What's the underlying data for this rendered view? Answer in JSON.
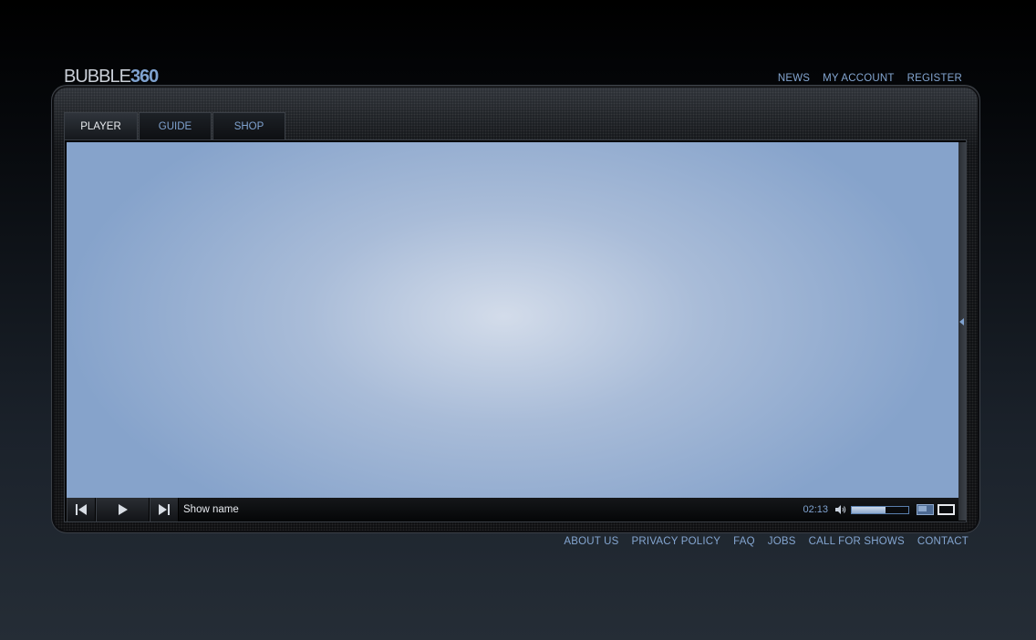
{
  "logo": {
    "word": "BUBBLE",
    "number": "360"
  },
  "top_nav": [
    "NEWS",
    "MY ACCOUNT",
    "REGISTER"
  ],
  "tabs": [
    {
      "label": "PLAYER",
      "active": true
    },
    {
      "label": "GUIDE",
      "active": false
    },
    {
      "label": "SHOP",
      "active": false
    }
  ],
  "player": {
    "show_name": "Show name",
    "time": "02:13",
    "volume_fraction": 0.6,
    "icons": [
      "skip-previous-icon",
      "play-icon",
      "skip-next-icon",
      "volume-icon",
      "window-size-icon",
      "fullscreen-icon",
      "collapse-arrow-icon"
    ]
  },
  "footer_nav": [
    "ABOUT US",
    "PRIVACY POLICY",
    "FAQ",
    "JOBS",
    "CALL FOR SHOWS",
    "CONTACT"
  ],
  "colors": {
    "link": "#84a6d1",
    "video": "#a9bcd8",
    "background": "#000000"
  }
}
